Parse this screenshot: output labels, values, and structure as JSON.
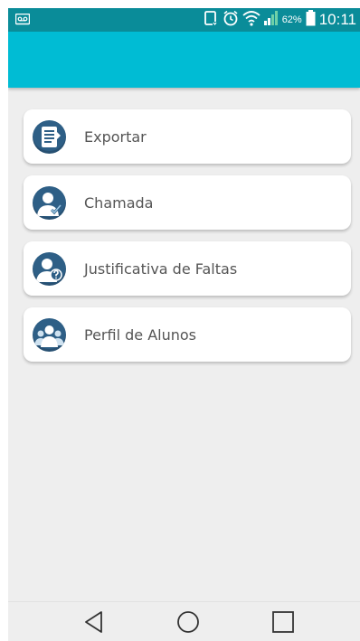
{
  "status_bar": {
    "battery_percent": "62%",
    "time": "10:11",
    "icons": [
      "voicemail-icon",
      "vibrate-icon",
      "alarm-icon",
      "wifi-icon",
      "signal-icon",
      "battery-icon"
    ]
  },
  "app_bar": {
    "title": "",
    "color": "#00bcd4"
  },
  "menu": {
    "items": [
      {
        "label": "Exportar",
        "icon": "document-export-icon"
      },
      {
        "label": "Chamada",
        "icon": "person-check-icon"
      },
      {
        "label": "Justificativa de Faltas",
        "icon": "person-question-icon"
      },
      {
        "label": "Perfil de Alunos",
        "icon": "group-users-icon"
      }
    ]
  },
  "nav_bar": {
    "buttons": [
      "back-icon",
      "home-icon",
      "recents-icon"
    ]
  },
  "colors": {
    "status_bar": "#0a8c99",
    "app_bar": "#00bcd4",
    "icon_circle": "#2e5f86",
    "background": "#eeeeee",
    "label_text": "#555555"
  }
}
